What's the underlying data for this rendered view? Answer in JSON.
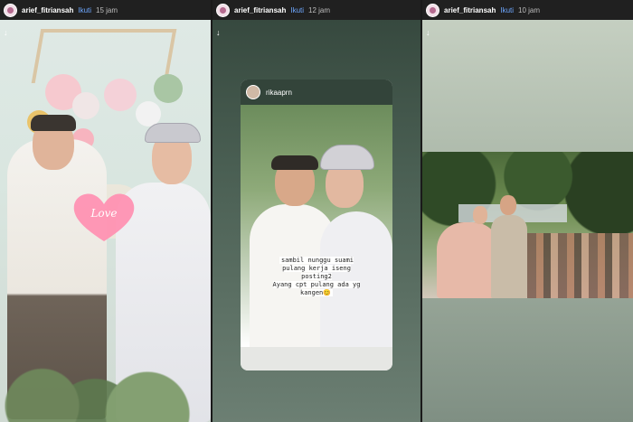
{
  "stories": [
    {
      "username": "arief_fitriansah",
      "follow_label": "Ikuti",
      "time": "15 jam",
      "sticker_text": "Love"
    },
    {
      "username": "arief_fitriansah",
      "follow_label": "Ikuti",
      "time": "12 jam",
      "repost": {
        "username": "rikaaprn",
        "caption": "sambil nunggu suami\npulang kerja iseng\nposting2\nAyang cpt pulang ada yg\nkangen😊"
      }
    },
    {
      "username": "arief_fitriansah",
      "follow_label": "Ikuti",
      "time": "10 jam"
    }
  ],
  "icons": {
    "download": "down-arrow-icon",
    "avatar": "avatar"
  },
  "colors": {
    "header_bg": "#202020",
    "follow": "#6ea8ff",
    "sticker": "#ff8fb1"
  }
}
